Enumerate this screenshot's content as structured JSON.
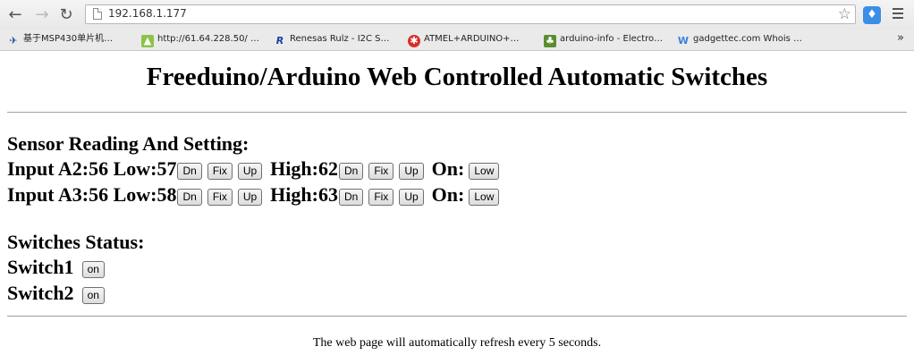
{
  "browser": {
    "url": "192.168.1.177",
    "bookmarks": [
      {
        "label": "基于MSP430单片机…",
        "icon": "bird-icon"
      },
      {
        "label": "http://61.64.228.50/ …",
        "icon": "android-icon"
      },
      {
        "label": "Renesas Rulz - I2C S…",
        "icon": "renesas-r-icon"
      },
      {
        "label": "ATMEL+ARDUINO+…",
        "icon": "chip-icon"
      },
      {
        "label": "arduino-info - Electro…",
        "icon": "plant-icon"
      },
      {
        "label": "gadgettec.com Whois …",
        "icon": "w-icon"
      }
    ],
    "ext_glyph": "♦",
    "more_glyph": "»"
  },
  "page": {
    "title": "Freeduino/Arduino Web Controlled Automatic Switches",
    "sensor_heading": "Sensor Reading And Setting:",
    "inputs": [
      {
        "label": "Input A2:",
        "value": "56",
        "low_label": "Low:",
        "low": "57",
        "high_label": "High:",
        "high": "62",
        "on_label": "On:",
        "on_state": "Low"
      },
      {
        "label": "Input A3:",
        "value": "56",
        "low_label": "Low:",
        "low": "58",
        "high_label": "High:",
        "high": "63",
        "on_label": "On:",
        "on_state": "Low"
      }
    ],
    "buttons": {
      "dn": "Dn",
      "fix": "Fix",
      "up": "Up"
    },
    "switches_heading": "Switches Status:",
    "switches": [
      {
        "label": "Switch1",
        "state": "on"
      },
      {
        "label": "Switch2",
        "state": "on"
      }
    ],
    "footer": "The web page will automatically refresh every 5 seconds."
  }
}
